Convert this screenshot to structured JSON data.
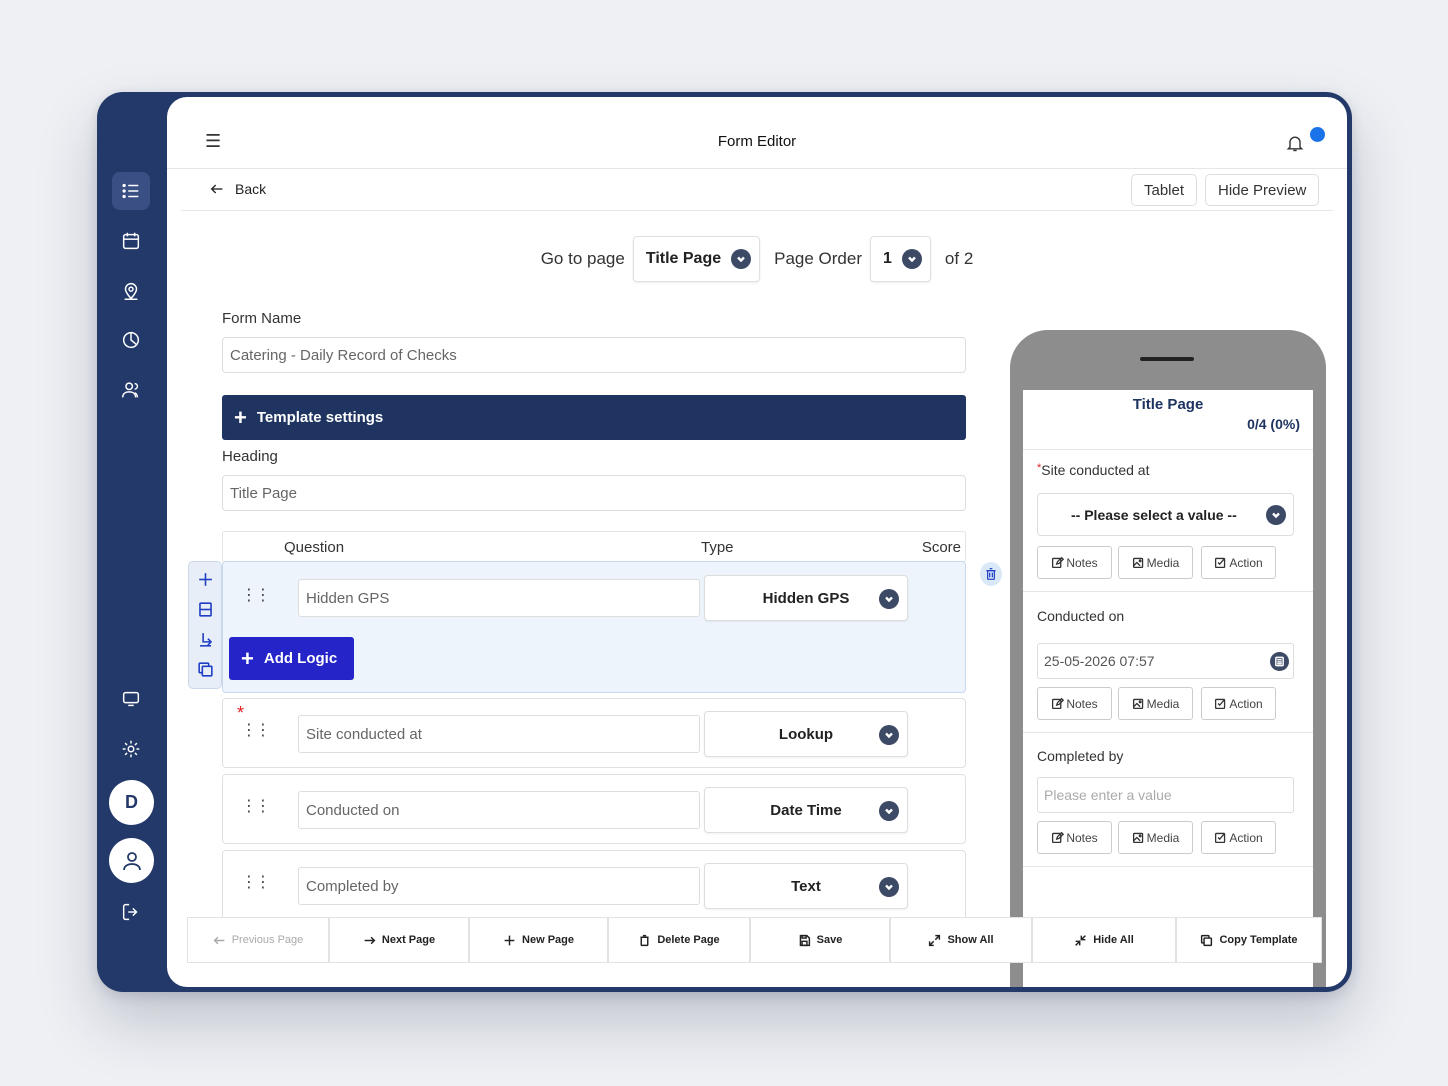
{
  "app": {
    "title": "Form Editor"
  },
  "nav": {
    "back_label": "Back",
    "tablet_label": "Tablet",
    "hide_preview_label": "Hide Preview"
  },
  "user": {
    "initial": "D"
  },
  "goto": {
    "label": "Go to page",
    "page_value": "Title Page",
    "order_label": "Page Order",
    "order_value": "1",
    "of_label": "of 2"
  },
  "form": {
    "name_label": "Form Name",
    "name_value": "Catering - Daily Record of Checks",
    "template_settings_label": "Template settings",
    "heading_label": "Heading",
    "heading_value": "Title Page"
  },
  "questions": {
    "headers": {
      "question": "Question",
      "type": "Type",
      "score": "Score"
    },
    "items": [
      {
        "text": "Hidden GPS",
        "type": "Hidden GPS"
      },
      {
        "text": "Site conducted at",
        "type": "Lookup",
        "required_mark": "*"
      },
      {
        "text": "Conducted on",
        "type": "Date Time"
      },
      {
        "text": "Completed by",
        "type": "Text"
      }
    ],
    "add_logic_label": "Add Logic"
  },
  "preview": {
    "title": "Title Page",
    "progress": "0/4 (0%)",
    "q1_label": "Site conducted at",
    "q1_required": "*",
    "q1_select": "-- Please select a value --",
    "q2_label": "Conducted on",
    "q2_value": "25-05-2026 07:57",
    "q3_label": "Completed by",
    "q3_placeholder": "Please enter a value",
    "notes_label": "Notes",
    "media_label": "Media",
    "action_label": "Action"
  },
  "footer": {
    "prev": "Previous Page",
    "next": "Next Page",
    "new": "New Page",
    "delete": "Delete Page",
    "save": "Save",
    "show_all": "Show All",
    "hide_all": "Hide All",
    "copy": "Copy Template"
  },
  "colors": {
    "sidebar": "#23396a",
    "template_bar": "#1f3461",
    "add_logic": "#2424c8",
    "accent_blue": "#1a73e8",
    "required": "#e02020"
  }
}
